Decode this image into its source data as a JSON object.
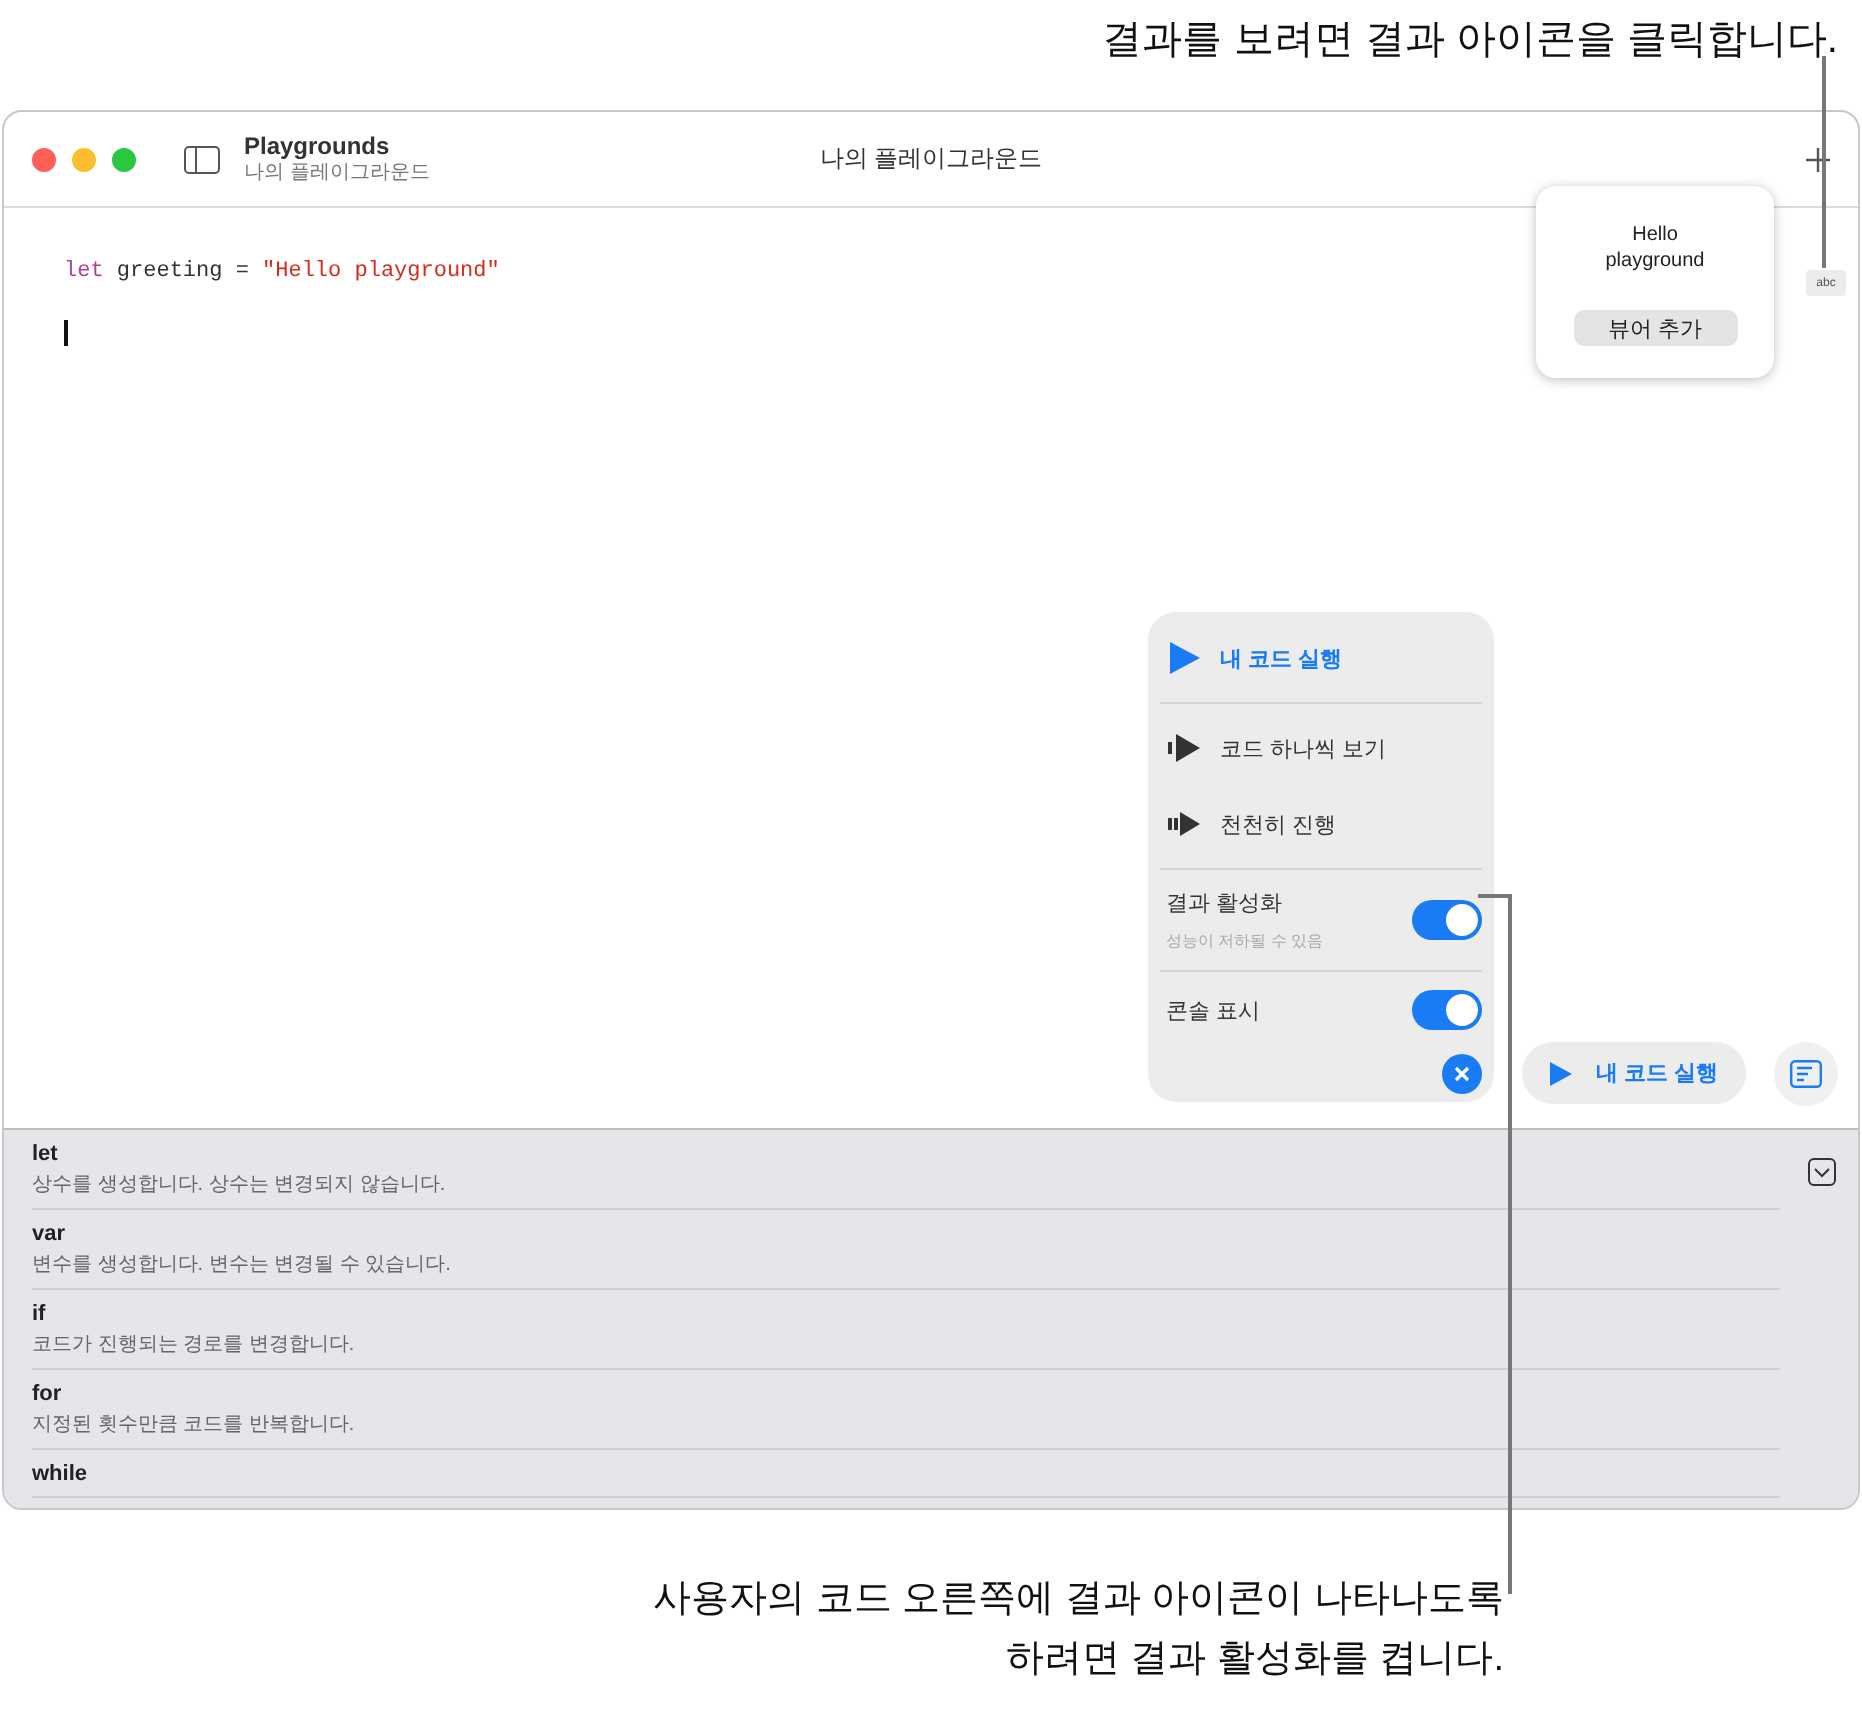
{
  "callout_top": "결과를 보려면 결과 아이콘을 클릭합니다.",
  "window": {
    "app": "Playgrounds",
    "subtitle": "나의 플레이그라운드",
    "title": "나의 플레이그라운드"
  },
  "code_lines": [
    {
      "tokens": [
        {
          "kind": "keyword",
          "text": "let"
        },
        {
          "kind": "plain",
          "text": " greeting = "
        },
        {
          "kind": "string",
          "text": "\"Hello playground\""
        }
      ]
    }
  ],
  "result_popover": {
    "value": "Hello playground",
    "button": "뷰어 추가",
    "icon_label": "abc"
  },
  "run_menu": [
    {
      "kind": "run",
      "label": "내 코드 실행"
    },
    {
      "kind": "step",
      "label": "코드 하나씩 보기"
    },
    {
      "kind": "slow",
      "label": "천천히 진행"
    },
    {
      "kind": "toggle",
      "label": "결과 활성화",
      "subtitle": "성능이 저하될 수 있음",
      "on": true
    },
    {
      "kind": "toggle",
      "label": "콘솔 표시",
      "on": true
    }
  ],
  "run_button": "내 코드 실행",
  "completions": [
    {
      "keyword": "let",
      "description": "상수를 생성합니다. 상수는 변경되지 않습니다."
    },
    {
      "keyword": "var",
      "description": "변수를 생성합니다. 변수는 변경될 수 있습니다."
    },
    {
      "keyword": "if",
      "description": "코드가 진행되는 경로를 변경합니다."
    },
    {
      "keyword": "for",
      "description": "지정된 횟수만큼 코드를 반복합니다."
    },
    {
      "keyword": "while"
    }
  ],
  "callout_bottom": "사용자의 코드 오른쪽에 결과 아이콘이 나타나도록 하려면 결과 활성화를 켭니다."
}
